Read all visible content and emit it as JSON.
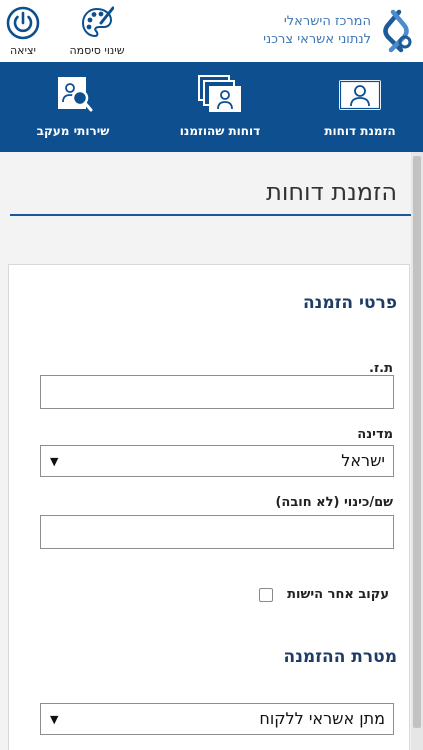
{
  "header": {
    "brand_line1": "המרכז הישראלי",
    "brand_line2": "לנתוני אשראי צרכני",
    "logout_label": "יציאה",
    "change_password_label": "שינוי סיסמה"
  },
  "nav": {
    "items": [
      {
        "label": "הזמנת דוחות",
        "icon": "id-card-icon"
      },
      {
        "label": "דוחות שהוזמנו",
        "icon": "stacked-reports-icon"
      },
      {
        "label": "שירותי מעקב",
        "icon": "magnifier-person-icon"
      }
    ]
  },
  "page": {
    "title": "הזמנת דוחות"
  },
  "form": {
    "details_heading": "פרטי הזמנה",
    "id_label": "ת.ז.",
    "id_value": "",
    "country_label": "מדינה",
    "country_value": "ישראל",
    "name_label": "שם/כינוי (לא חובה)",
    "name_value": "",
    "track_checkbox_label": "עקוב אחר הישות",
    "track_checked": false,
    "purpose_heading": "מטרת ההזמנה",
    "purpose_value": "מתן אשראי ללקוח"
  },
  "colors": {
    "nav_background": "#0e4f8f",
    "brand_blue": "#3f78b6",
    "heading_blue": "#1f3c66",
    "accent_line": "#1a5a9c"
  }
}
